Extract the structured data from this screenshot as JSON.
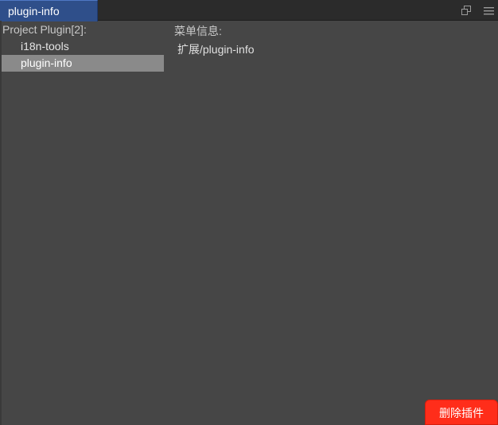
{
  "tab": {
    "title": "plugin-info"
  },
  "window_actions": {
    "popout_icon": "popout-window-icon",
    "menu_icon": "hamburger-menu-icon"
  },
  "plugin_list": {
    "header": "Project Plugin[2]:",
    "items": [
      {
        "label": "i18n-tools",
        "selected": false
      },
      {
        "label": "plugin-info",
        "selected": true
      }
    ]
  },
  "detail": {
    "menu_label": "菜单信息:",
    "menu_value": "扩展/plugin-info"
  },
  "actions": {
    "delete_label": "删除插件"
  },
  "colors": {
    "tab_active": "#2f4f8a",
    "panel_bg": "#464646",
    "selected_row": "#8a8a8a",
    "delete_button": "#ff2d1a"
  }
}
